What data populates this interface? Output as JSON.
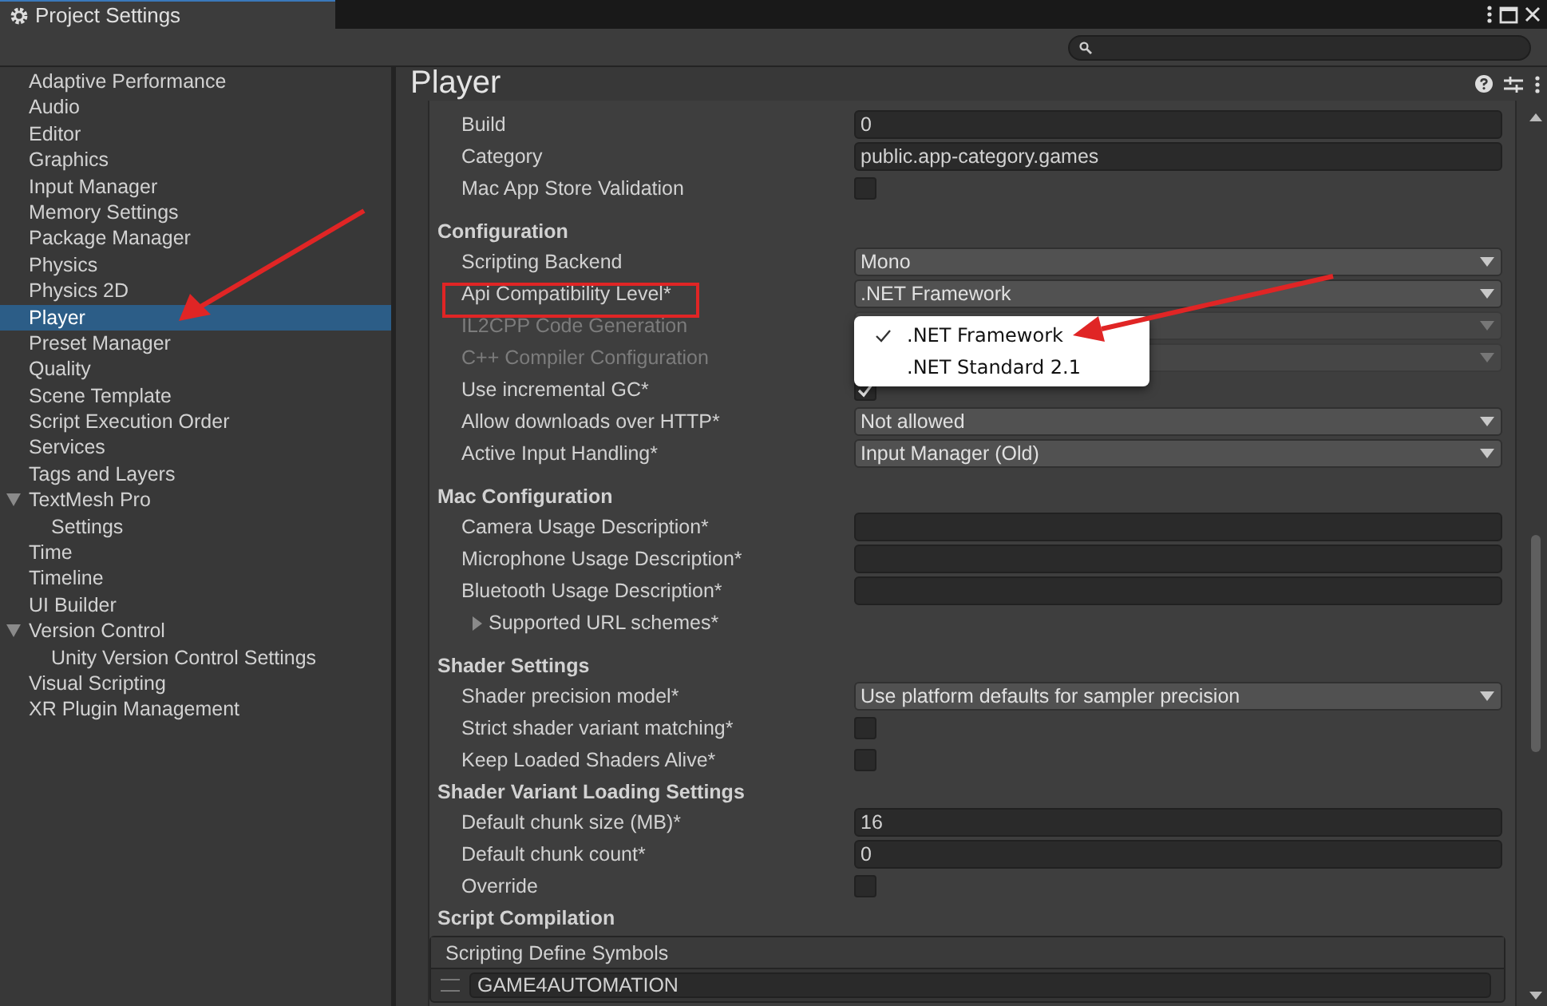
{
  "window": {
    "title": "Project Settings"
  },
  "sidebar": {
    "items": [
      {
        "label": "Adaptive Performance",
        "selected": false
      },
      {
        "label": "Audio",
        "selected": false
      },
      {
        "label": "Editor",
        "selected": false
      },
      {
        "label": "Graphics",
        "selected": false
      },
      {
        "label": "Input Manager",
        "selected": false
      },
      {
        "label": "Memory Settings",
        "selected": false
      },
      {
        "label": "Package Manager",
        "selected": false
      },
      {
        "label": "Physics",
        "selected": false
      },
      {
        "label": "Physics 2D",
        "selected": false
      },
      {
        "label": "Player",
        "selected": true
      },
      {
        "label": "Preset Manager",
        "selected": false
      },
      {
        "label": "Quality",
        "selected": false
      },
      {
        "label": "Scene Template",
        "selected": false
      },
      {
        "label": "Script Execution Order",
        "selected": false
      },
      {
        "label": "Services",
        "selected": false
      },
      {
        "label": "Tags and Layers",
        "selected": false
      },
      {
        "label": "TextMesh Pro",
        "selected": false,
        "expanded": true,
        "children": [
          {
            "label": "Settings",
            "selected": false
          }
        ]
      },
      {
        "label": "Time",
        "selected": false
      },
      {
        "label": "Timeline",
        "selected": false
      },
      {
        "label": "UI Builder",
        "selected": false
      },
      {
        "label": "Version Control",
        "selected": false,
        "expanded": true,
        "children": [
          {
            "label": "Unity Version Control Settings",
            "selected": false
          }
        ]
      },
      {
        "label": "Visual Scripting",
        "selected": false
      },
      {
        "label": "XR Plugin Management",
        "selected": false
      }
    ]
  },
  "panel": {
    "title": "Player",
    "rows": [
      {
        "kind": "text",
        "label": "Build",
        "value": "0"
      },
      {
        "kind": "text",
        "label": "Category",
        "value": "public.app-category.games"
      },
      {
        "kind": "checkbox",
        "label": "Mac App Store Validation",
        "checked": false
      },
      {
        "kind": "header",
        "label": "Configuration"
      },
      {
        "kind": "dropdown",
        "label": "Scripting Backend",
        "value": "Mono",
        "disabled": false
      },
      {
        "kind": "dropdown",
        "label": "Api Compatibility Level*",
        "value": ".NET Framework",
        "disabled": false,
        "highlighted": true
      },
      {
        "kind": "dropdown",
        "label": "IL2CPP Code Generation",
        "disabled": true
      },
      {
        "kind": "dropdown",
        "label": "C++ Compiler Configuration",
        "disabled": true
      },
      {
        "kind": "checkbox",
        "label": "Use incremental GC*",
        "checked": true
      },
      {
        "kind": "dropdown",
        "label": "Allow downloads over HTTP*",
        "value": "Not allowed",
        "disabled": false
      },
      {
        "kind": "dropdown",
        "label": "Active Input Handling*",
        "value": "Input Manager (Old)",
        "disabled": false
      },
      {
        "kind": "header",
        "label": "Mac Configuration"
      },
      {
        "kind": "text",
        "label": "Camera Usage Description*"
      },
      {
        "kind": "text",
        "label": "Microphone Usage Description*"
      },
      {
        "kind": "text",
        "label": "Bluetooth Usage Description*"
      },
      {
        "kind": "foldout",
        "label": "Supported URL schemes*",
        "expanded": false
      },
      {
        "kind": "header",
        "label": "Shader Settings"
      },
      {
        "kind": "dropdown",
        "label": "Shader precision model*",
        "value": "Use platform defaults for sampler precision",
        "disabled": false
      },
      {
        "kind": "checkbox",
        "label": "Strict shader variant matching*",
        "checked": false
      },
      {
        "kind": "checkbox",
        "label": "Keep Loaded Shaders Alive*",
        "checked": false
      },
      {
        "kind": "subheader",
        "label": "Shader Variant Loading Settings"
      },
      {
        "kind": "text",
        "label": "Default chunk size (MB)*",
        "value": "16"
      },
      {
        "kind": "text",
        "label": "Default chunk count*",
        "value": "0"
      },
      {
        "kind": "checkbox",
        "label": "Override",
        "checked": false
      },
      {
        "kind": "subheader",
        "label": "Script Compilation"
      }
    ],
    "define_symbols": {
      "title": "Scripting Define Symbols",
      "items": [
        "GAME4AUTOMATION"
      ]
    }
  },
  "popup": {
    "items": [
      {
        "label": ".NET Framework",
        "selected": true
      },
      {
        "label": ".NET Standard 2.1",
        "selected": false
      }
    ]
  }
}
